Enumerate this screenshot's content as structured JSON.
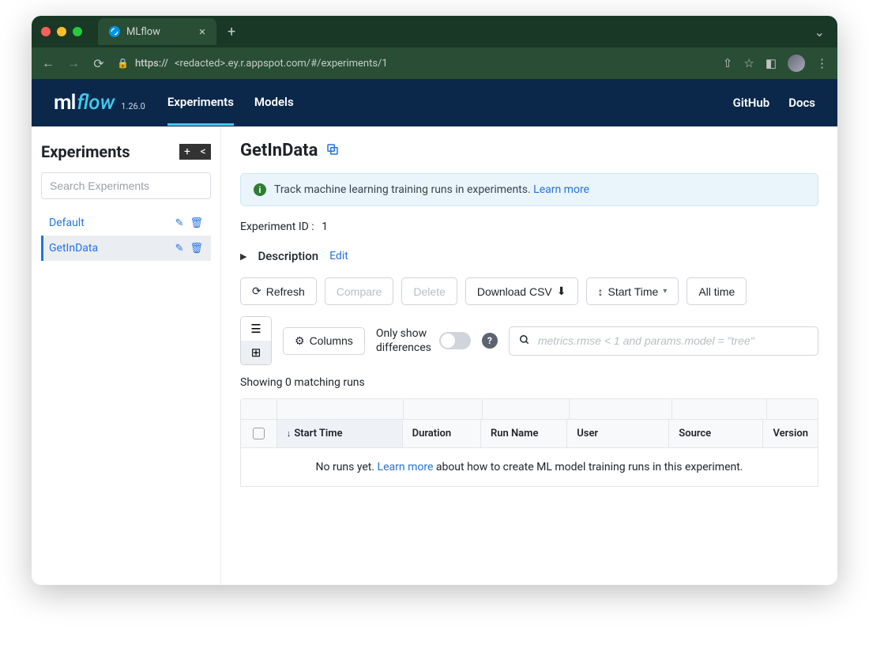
{
  "browser": {
    "tab_title": "MLflow",
    "url_prefix": "https://",
    "url_display": "<redacted>.ey.r.appspot.com/#/experiments/1"
  },
  "header": {
    "logo_text_1": "ml",
    "logo_text_2": "flow",
    "version": "1.26.0",
    "nav": {
      "experiments": "Experiments",
      "models": "Models"
    },
    "right": {
      "github": "GitHub",
      "docs": "Docs"
    }
  },
  "sidebar": {
    "title": "Experiments",
    "search_placeholder": "Search Experiments",
    "items": [
      {
        "label": "Default"
      },
      {
        "label": "GetInData"
      }
    ]
  },
  "main": {
    "title": "GetInData",
    "banner_text": "Track machine learning training runs in experiments. ",
    "banner_link": "Learn more",
    "experiment_id_label": "Experiment ID :",
    "experiment_id_value": "1",
    "description_label": "Description",
    "description_edit": "Edit",
    "buttons": {
      "refresh": "Refresh",
      "compare": "Compare",
      "delete": "Delete",
      "download_csv": "Download CSV",
      "sort": "Start Time",
      "time_filter": "All time",
      "columns": "Columns"
    },
    "diff_label_1": "Only show",
    "diff_label_2": "differences",
    "search_placeholder": "metrics.rmse < 1 and params.model = \"tree\"",
    "showing_text": "Showing 0 matching runs",
    "columns": {
      "start_time": "Start Time",
      "duration": "Duration",
      "run_name": "Run Name",
      "user": "User",
      "source": "Source",
      "version": "Version"
    },
    "empty_prefix": "No runs yet. ",
    "empty_link": "Learn more",
    "empty_suffix": " about how to create ML model training runs in this experiment."
  }
}
